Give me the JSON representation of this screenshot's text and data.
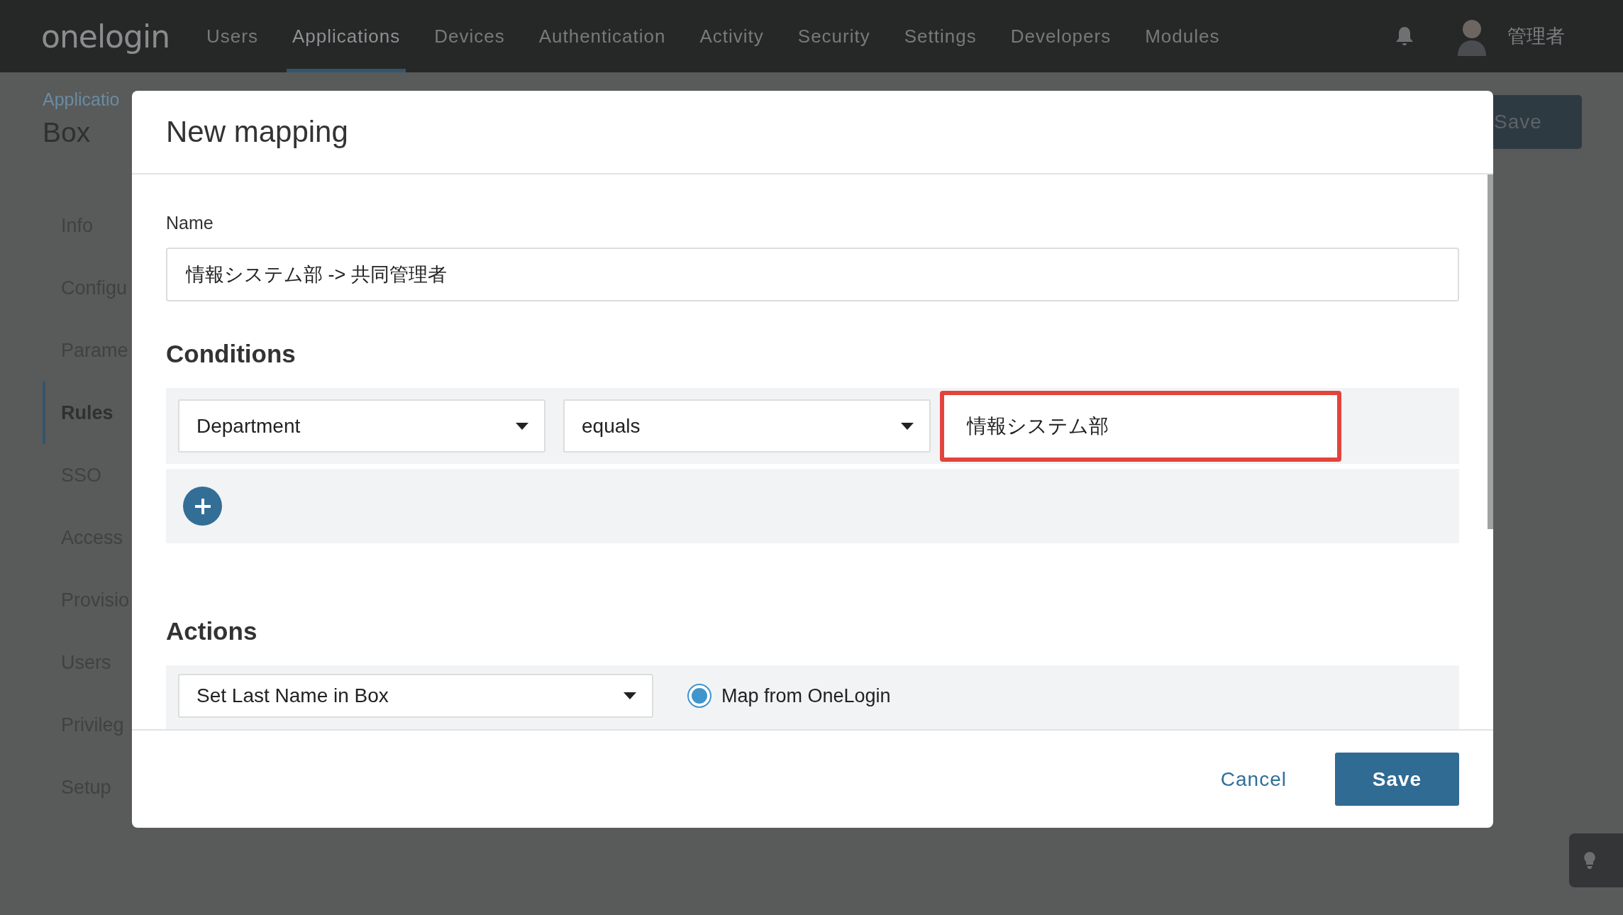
{
  "nav": {
    "logo": "onelogin",
    "items": [
      {
        "label": "Users",
        "selected": false
      },
      {
        "label": "Applications",
        "selected": true
      },
      {
        "label": "Devices",
        "selected": false
      },
      {
        "label": "Authentication",
        "selected": false
      },
      {
        "label": "Activity",
        "selected": false
      },
      {
        "label": "Security",
        "selected": false
      },
      {
        "label": "Settings",
        "selected": false
      },
      {
        "label": "Developers",
        "selected": false
      },
      {
        "label": "Modules",
        "selected": false
      }
    ],
    "user": "管理者"
  },
  "page": {
    "breadcrumb": "Applicatio",
    "title": "Box",
    "save_button": "Save",
    "sidebar": [
      {
        "label": "Info",
        "selected": false
      },
      {
        "label": "Configu",
        "selected": false
      },
      {
        "label": "Parame",
        "selected": false
      },
      {
        "label": "Rules",
        "selected": true
      },
      {
        "label": "SSO",
        "selected": false
      },
      {
        "label": "Access",
        "selected": false
      },
      {
        "label": "Provisio",
        "selected": false
      },
      {
        "label": "Users",
        "selected": false
      },
      {
        "label": "Privileg",
        "selected": false
      },
      {
        "label": "Setup",
        "selected": false
      }
    ]
  },
  "dialog": {
    "title": "New mapping",
    "name_label": "Name",
    "name_value": "情報システム部 -> 共同管理者",
    "conditions_heading": "Conditions",
    "conditions": [
      {
        "field": "Department",
        "operator": "equals",
        "value": "情報システム部",
        "highlighted": true
      }
    ],
    "actions_heading": "Actions",
    "actions": [
      {
        "action": "Set Last Name in Box",
        "option": "Map from OneLogin",
        "selected": true
      }
    ],
    "cancel": "Cancel",
    "save": "Save"
  }
}
